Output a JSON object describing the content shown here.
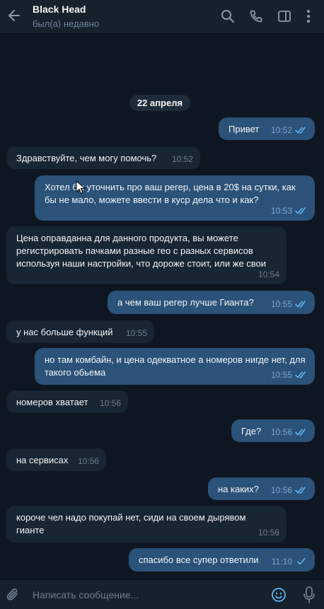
{
  "header": {
    "title": "Black Head",
    "status": "был(а) недавно"
  },
  "date_divider": "22 апреля",
  "messages": [
    {
      "dir": "out",
      "text": "Привет",
      "time": "10:52",
      "checks": "double"
    },
    {
      "dir": "in",
      "text": "Здравствуйте, чем могу помочь?",
      "time": "10:52"
    },
    {
      "dir": "out",
      "text": "Хотел бы уточнить про ваш регер, цена в 20$ на сутки, как бы не мало, можете ввести в куср дела что и как?",
      "time": "10:53",
      "checks": "double"
    },
    {
      "dir": "in",
      "text": "Цена оправданна для данного продукта, вы можете регистрировать пачками разные гео с разных сервисов используя наши настройки, что дороже стоит, или же свои",
      "time": "10:54"
    },
    {
      "dir": "out",
      "text": "а чем ваш регер лучше  Гианта?",
      "time": "10:55",
      "checks": "double"
    },
    {
      "dir": "in",
      "text": "у нас больше функций",
      "time": "10:55"
    },
    {
      "dir": "out",
      "text": "но там комбайн, и цена одекватное а номеров нигде нет, для такого обьема",
      "time": "10:55",
      "checks": "double"
    },
    {
      "dir": "in",
      "text": "номеров хватает",
      "time": "10:56"
    },
    {
      "dir": "out",
      "text": "Где?",
      "time": "10:56",
      "checks": "double"
    },
    {
      "dir": "in",
      "text": "на сервисах",
      "time": "10:56"
    },
    {
      "dir": "out",
      "text": "на каких?",
      "time": "10:56",
      "checks": "double"
    },
    {
      "dir": "in",
      "text": "короче чел надо покупай нет, сиди на своем дырявом гианте",
      "time": "10:56"
    },
    {
      "dir": "out",
      "text": "спасибо все супер ответили",
      "time": "11:10",
      "checks": "single"
    }
  ],
  "composer": {
    "placeholder": "Написать сообщение..."
  },
  "colors": {
    "background": "#0e1621",
    "header": "#17212b",
    "incoming": "#182533",
    "outgoing": "#2b5278",
    "accent": "#5eb5f7"
  },
  "icons": [
    "back-arrow-icon",
    "search-icon",
    "phone-icon",
    "sidebar-icon",
    "more-vertical-icon",
    "paperclip-icon",
    "emoji-icon",
    "microphone-icon"
  ]
}
